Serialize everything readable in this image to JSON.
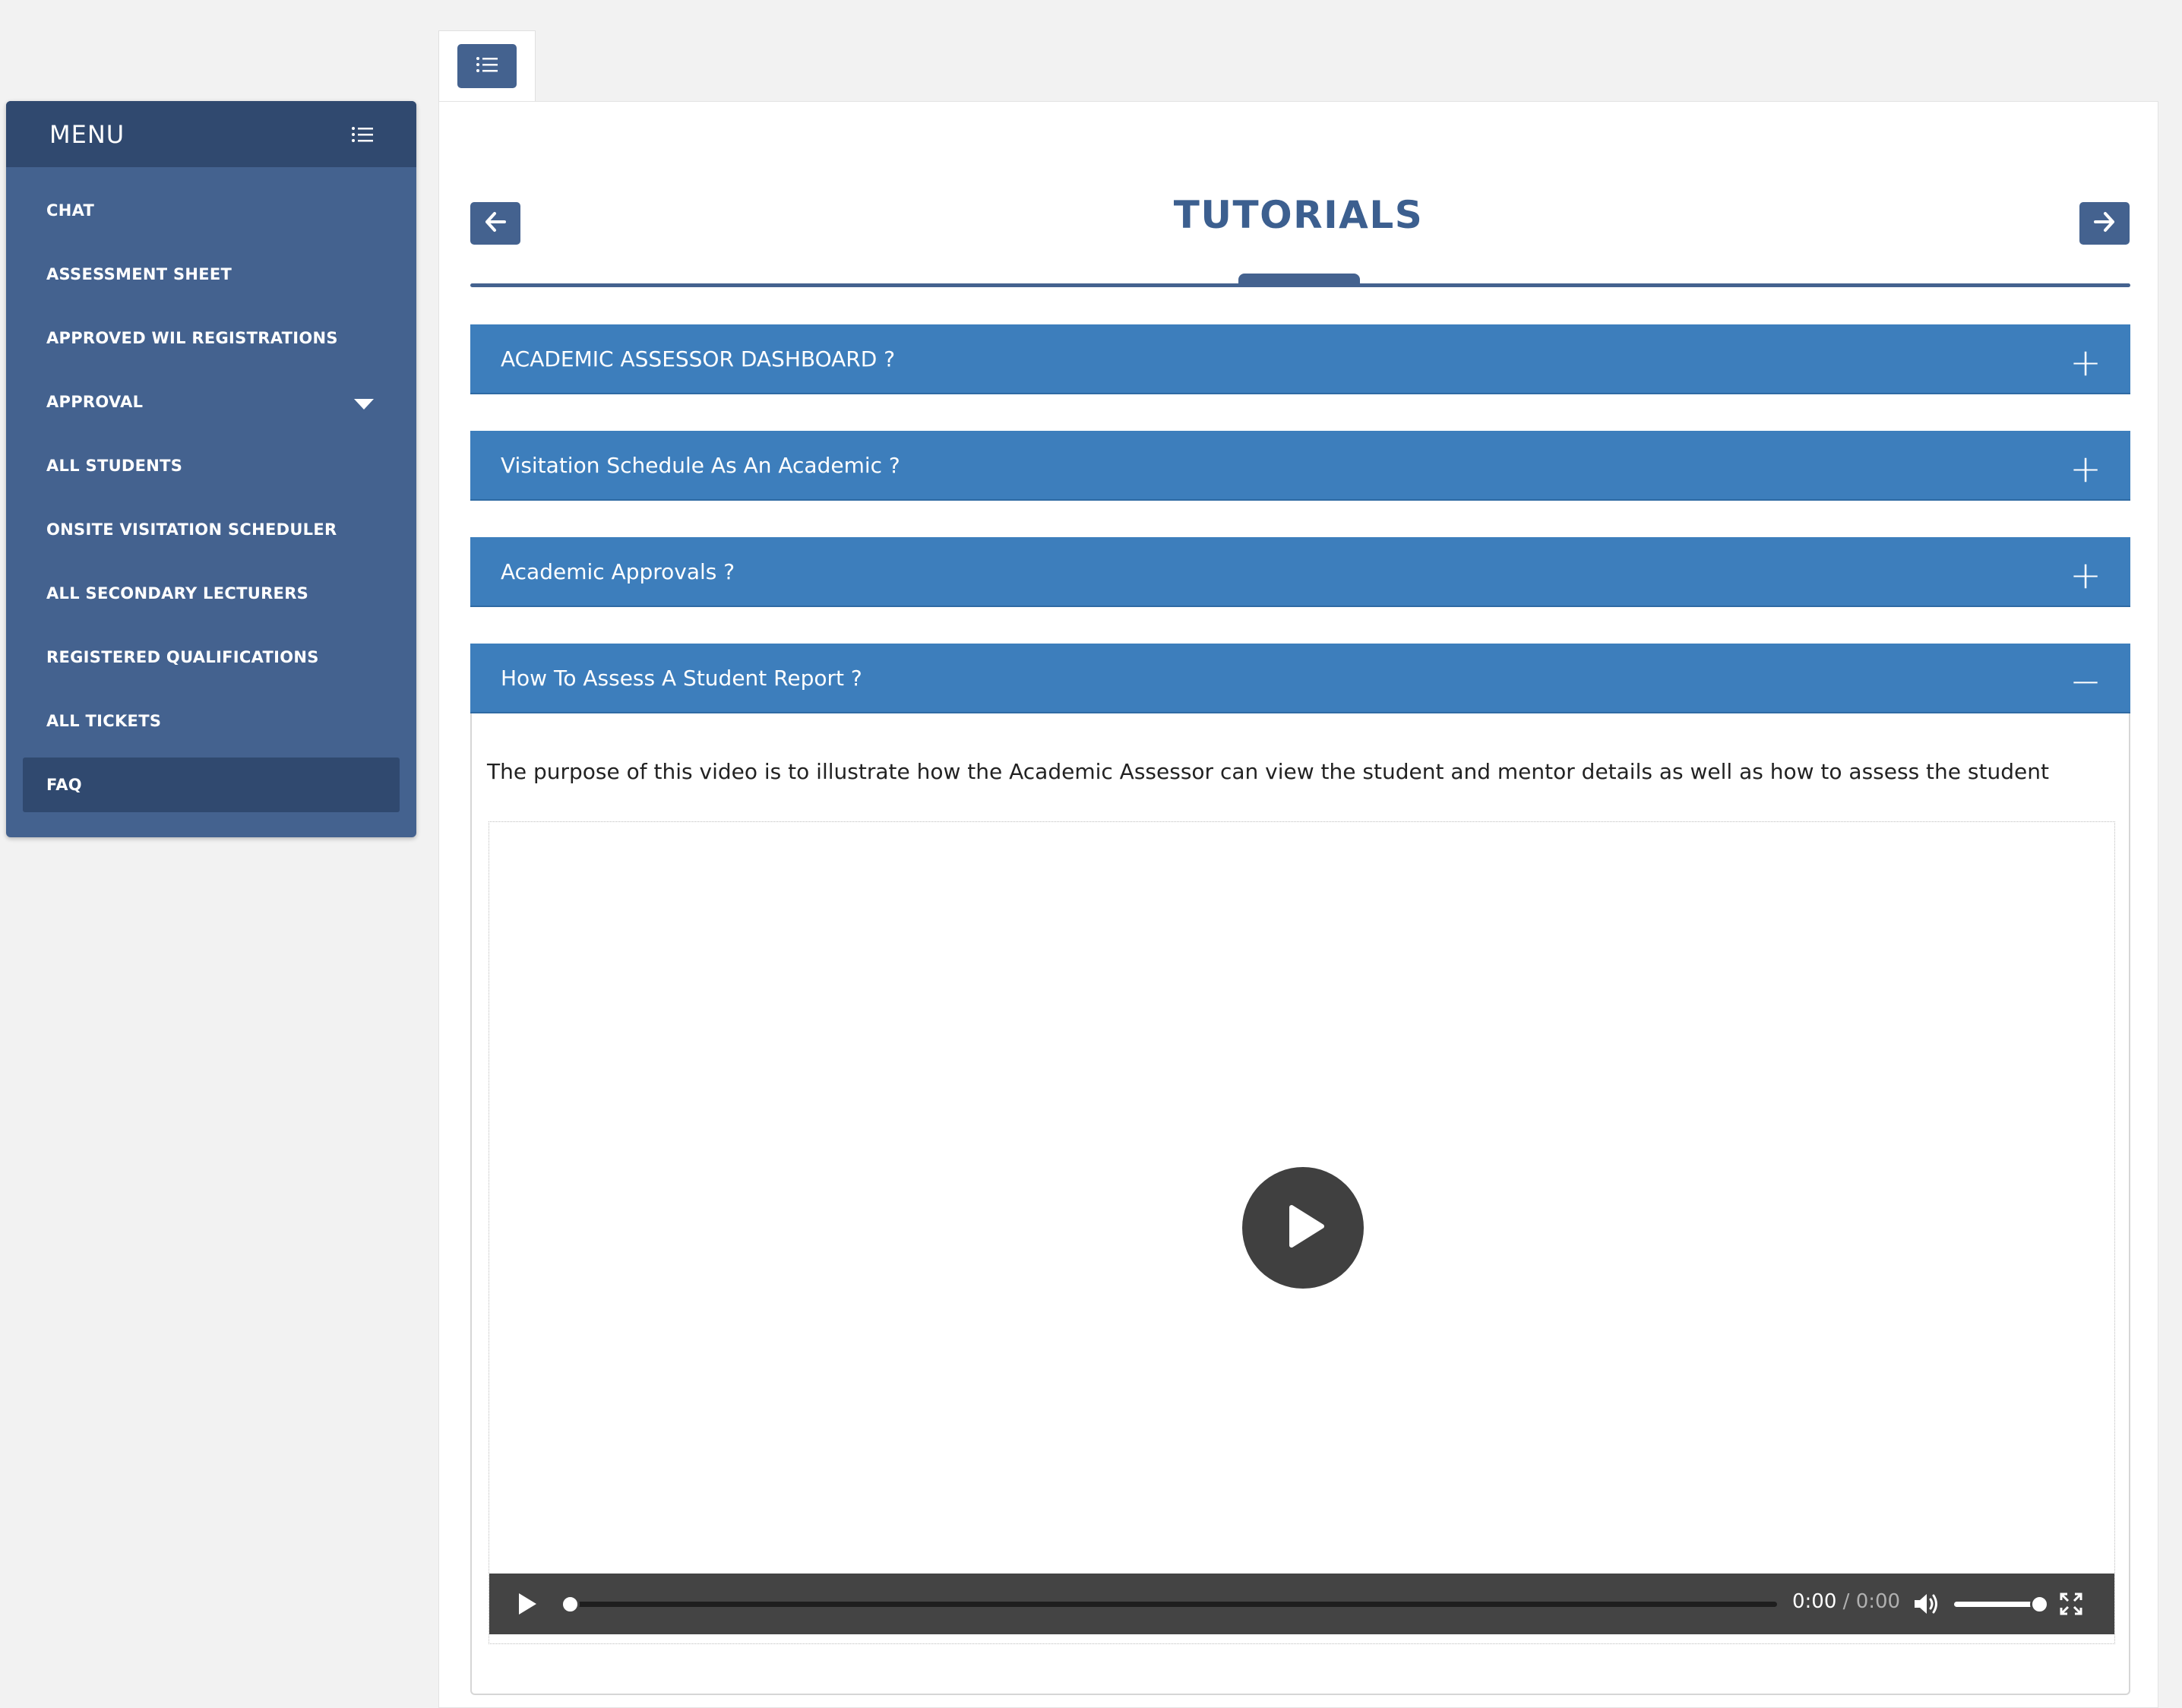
{
  "sidebar": {
    "title": "MENU",
    "items": [
      {
        "label": "CHAT"
      },
      {
        "label": "ASSESSMENT SHEET"
      },
      {
        "label": "APPROVED WIL REGISTRATIONS"
      },
      {
        "label": "APPROVAL"
      },
      {
        "label": "ALL STUDENTS"
      },
      {
        "label": "ONSITE VISITATION SCHEDULER"
      },
      {
        "label": "ALL SECONDARY LECTURERS"
      },
      {
        "label": "REGISTERED QUALIFICATIONS"
      },
      {
        "label": "ALL TICKETS"
      },
      {
        "label": "FAQ"
      }
    ],
    "active_item": "FAQ"
  },
  "page": {
    "title": "TUTORIALS"
  },
  "accordion": [
    {
      "label": "ACADEMIC ASSESSOR DASHBOARD ?",
      "expanded": false,
      "sign": "+"
    },
    {
      "label": "Visitation Schedule As An Academic ?",
      "expanded": false,
      "sign": "+"
    },
    {
      "label": "Academic Approvals ?",
      "expanded": false,
      "sign": "+"
    },
    {
      "label": "How To Assess A Student Report ?",
      "expanded": true,
      "sign": "−"
    }
  ],
  "expanded_content": {
    "description": "The purpose of this video is to illustrate how the Academic Assessor can view the student and mentor details as well as how to assess the student"
  },
  "video": {
    "current_time": "0:00",
    "separator": "/",
    "duration": "0:00",
    "progress": 0,
    "volume": 1
  },
  "colors": {
    "sidebar": "#44628f",
    "sidebar_dark": "#30496f",
    "accordion": "#3d7ebc",
    "title": "#3c5f8f"
  },
  "icons": [
    "list-icon",
    "arrow-left-icon",
    "arrow-right-icon",
    "caret-down-icon",
    "play-icon",
    "volume-icon",
    "fullscreen-icon",
    "plus-icon",
    "minus-icon"
  ]
}
